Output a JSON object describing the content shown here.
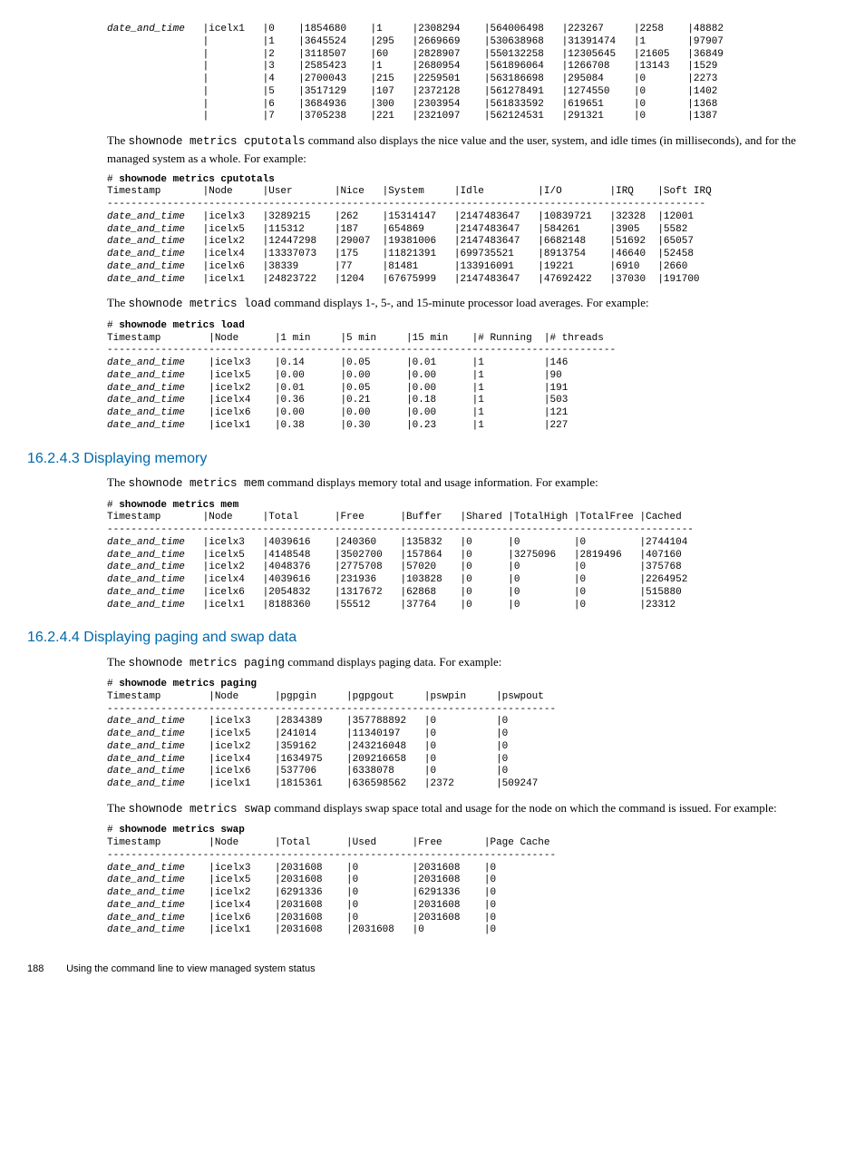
{
  "topTable": "date_and_time   |icelx1   |0    |1854680    |1     |2308294    |564006498   |223267     |2258    |48882\n                |         |1    |3645524    |295   |2669669    |530638968   |31391474   |1       |97907\n                |         |2    |3118507    |60    |2828907    |550132258   |12305645   |21605   |36849\n                |         |3    |2585423    |1     |2680954    |561896064   |1266708    |13143   |1529\n                |         |4    |2700043    |215   |2259501    |563186698   |295084     |0       |2273\n                |         |5    |3517129    |107   |2372128    |561278491   |1274550    |0       |1402\n                |         |6    |3684936    |300   |2303954    |561833592   |619651     |0       |1368\n                |         |7    |3705238    |221   |2321097    |562124531   |291321     |0       |1387",
  "para1a": "The ",
  "para1cmd": "shownode metrics cputotals",
  "para1b": " command also displays the nice value and the user, system, and idle times (in milliseconds), and for the managed system as a whole. For example:",
  "cputotals": "# shownode metrics cputotals\nTimestamp       |Node     |User       |Nice   |System     |Idle         |I/O        |IRQ    |Soft IRQ\n----------------------------------------------------------------------------------------------------\ndate_and_time   |icelx3   |3289215    |262    |15314147   |2147483647   |10839721   |32328  |12001\ndate_and_time   |icelx5   |115312     |187    |654869     |2147483647   |584261     |3905   |5582\ndate_and_time   |icelx2   |12447298   |29007  |19381006   |2147483647   |6682148    |51692  |65057\ndate_and_time   |icelx4   |13337073   |175    |11821391   |699735521    |8913754    |46640  |52458\ndate_and_time   |icelx6   |38339      |77     |81481      |133916091    |19221      |6910   |2660\ndate_and_time   |icelx1   |24823722   |1204   |67675999   |2147483647   |47692422   |37030  |191700",
  "para2a": "The ",
  "para2cmd": "shownode metrics load",
  "para2b": " command displays 1-, 5-, and 15-minute processor load averages. For example:",
  "load": "# shownode metrics load\nTimestamp        |Node      |1 min     |5 min     |15 min    |# Running  |# threads\n-------------------------------------------------------------------------------------\ndate_and_time    |icelx3    |0.14      |0.05      |0.01      |1          |146\ndate_and_time    |icelx5    |0.00      |0.00      |0.00      |1          |90\ndate_and_time    |icelx2    |0.01      |0.05      |0.00      |1          |191\ndate_and_time    |icelx4    |0.36      |0.21      |0.18      |1          |503\ndate_and_time    |icelx6    |0.00      |0.00      |0.00      |1          |121\ndate_and_time    |icelx1    |0.38      |0.30      |0.23      |1          |227",
  "sec1": "16.2.4.3 Displaying memory",
  "para3a": "The ",
  "para3cmd": "shownode metrics mem",
  "para3b": " command displays memory total and usage information. For example:",
  "mem": "# shownode metrics mem\nTimestamp       |Node     |Total      |Free      |Buffer   |Shared |TotalHigh |TotalFree |Cached\n--------------------------------------------------------------------------------------------------\ndate_and_time   |icelx3   |4039616    |240360    |135832   |0      |0         |0         |2744104\ndate_and_time   |icelx5   |4148548    |3502700   |157864   |0      |3275096   |2819496   |407160\ndate_and_time   |icelx2   |4048376    |2775708   |57020    |0      |0         |0         |375768\ndate_and_time   |icelx4   |4039616    |231936    |103828   |0      |0         |0         |2264952\ndate_and_time   |icelx6   |2054832    |1317672   |62868    |0      |0         |0         |515880\ndate_and_time   |icelx1   |8188360    |55512     |37764    |0      |0         |0         |23312",
  "sec2": "16.2.4.4 Displaying paging and swap data",
  "para4a": "The ",
  "para4cmd": "shownode metrics paging",
  "para4b": " command displays paging data. For example:",
  "paging": "# shownode metrics paging\nTimestamp        |Node      |pgpgin     |pgpgout     |pswpin     |pswpout\n---------------------------------------------------------------------------\ndate_and_time    |icelx3    |2834389    |357788892   |0          |0\ndate_and_time    |icelx5    |241014     |11340197    |0          |0\ndate_and_time    |icelx2    |359162     |243216048   |0          |0\ndate_and_time    |icelx4    |1634975    |209216658   |0          |0\ndate_and_time    |icelx6    |537706     |6338078     |0          |0\ndate_and_time    |icelx1    |1815361    |636598562   |2372       |509247",
  "para5a": "The ",
  "para5cmd": "shownode metrics swap",
  "para5b": " command displays swap space total and usage for the node on which the command is issued. For example:",
  "swap": "# shownode metrics swap\nTimestamp        |Node      |Total      |Used      |Free       |Page Cache\n---------------------------------------------------------------------------\ndate_and_time    |icelx3    |2031608    |0         |2031608    |0\ndate_and_time    |icelx5    |2031608    |0         |2031608    |0\ndate_and_time    |icelx2    |6291336    |0         |6291336    |0\ndate_and_time    |icelx4    |2031608    |0         |2031608    |0\ndate_and_time    |icelx6    |2031608    |0         |2031608    |0\ndate_and_time    |icelx1    |2031608    |2031608   |0          |0",
  "footerPage": "188",
  "footerText": "Using the command line to view managed system status"
}
